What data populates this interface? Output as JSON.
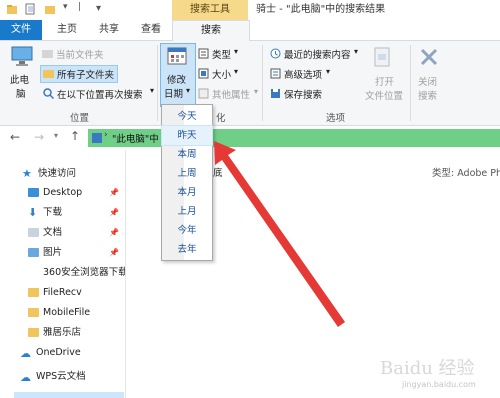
{
  "window": {
    "context_tab_title": "搜索工具",
    "title": "骑士 - \"此电脑\"中的搜索结果"
  },
  "tabs": [
    "文件",
    "主页",
    "共享",
    "查看",
    "搜索"
  ],
  "ribbon": {
    "location": {
      "this_pc": "此电脑",
      "this_pc_line2": "脑",
      "this_pc_line1": "此电",
      "current_folder": "当前文件夹",
      "all_subfolders": "所有子文件夹",
      "search_again_in": "在以下位置再次搜索",
      "group_label": "位置"
    },
    "refine": {
      "date_modified_line1": "修改",
      "date_modified_line2": "日期",
      "kind": "类型",
      "size": "大小",
      "other_properties": "其他属性",
      "group_label_partial": "化"
    },
    "options": {
      "recent_searches": "最近的搜索内容",
      "advanced_options": "高级选项",
      "save_search": "保存搜索",
      "open_location_line1": "打开",
      "open_location_line2": "文件位置",
      "group_label": "选项"
    },
    "close_search_line1": "关闭",
    "close_search_line2": "搜索"
  },
  "address": {
    "text": "\"此电脑\"中"
  },
  "nav": {
    "quick_access": "快速访问",
    "items": [
      {
        "label": "Desktop",
        "pinned": true
      },
      {
        "label": "下载",
        "pinned": true
      },
      {
        "label": "文档",
        "pinned": true
      },
      {
        "label": "图片",
        "pinned": true
      },
      {
        "label": "360安全浏览器下载",
        "pinned": false
      },
      {
        "label": "FileRecv",
        "pinned": false
      },
      {
        "label": "MobileFile",
        "pinned": false
      },
      {
        "label": "雅居乐店",
        "pinned": false
      }
    ],
    "onedrive": "OneDrive",
    "wps": "WPS云文档",
    "pin_glyph": "📌"
  },
  "content": {
    "result_name_partial": "底",
    "type_label": "类型: Adobe Ph"
  },
  "date_menu": [
    "今天",
    "昨天",
    "本周",
    "上周",
    "本月",
    "上月",
    "今年",
    "去年"
  ],
  "watermark": {
    "logo": "Baidu 经验",
    "url": "jingyan.baidu.com"
  },
  "colors": {
    "file_tab": "#1979ca",
    "context_tab": "#f6d98a",
    "address_highlight": "#6fcf86",
    "arrow": "#e53935"
  }
}
